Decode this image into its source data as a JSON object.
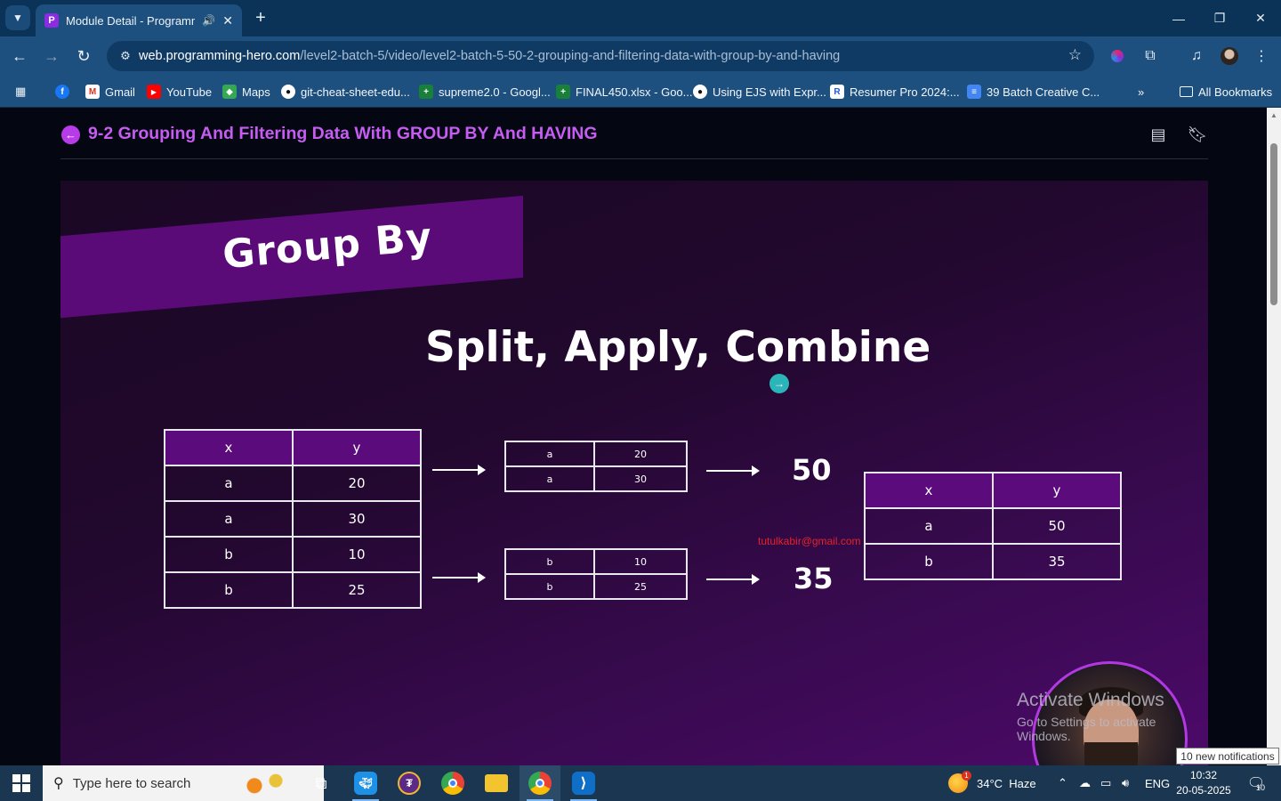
{
  "browser": {
    "tab": {
      "title": "Module Detail - Programmi",
      "favicon": "P"
    },
    "url": {
      "host": "web.programming-hero.com",
      "path": "/level2-batch-5/video/level2-batch-5-50-2-grouping-and-filtering-data-with-group-by-and-having"
    },
    "bookmarks": [
      {
        "label": "Gmail",
        "icon": "gmail-icon",
        "color": "#d93025",
        "glyph": "M"
      },
      {
        "label": "YouTube",
        "icon": "youtube-icon",
        "color": "#ff0000",
        "glyph": "▶"
      },
      {
        "label": "Maps",
        "icon": "maps-icon",
        "color": "#34a853",
        "glyph": "◆"
      },
      {
        "label": "git-cheat-sheet-edu...",
        "icon": "github-icon",
        "color": "#111111",
        "glyph": "●"
      },
      {
        "label": "supreme2.0 - Googl...",
        "icon": "sheets-icon",
        "color": "#188038",
        "glyph": "+"
      },
      {
        "label": "FINAL450.xlsx - Goo...",
        "icon": "sheets-icon",
        "color": "#188038",
        "glyph": "+"
      },
      {
        "label": "Using EJS with Expr...",
        "icon": "github-icon",
        "color": "#111111",
        "glyph": "●"
      },
      {
        "label": "Resumer Pro 2024:...",
        "icon": "resumer-icon",
        "color": "#2557d6",
        "glyph": "R"
      },
      {
        "label": "39 Batch Creative C...",
        "icon": "docs-icon",
        "color": "#4285f4",
        "glyph": "≡"
      }
    ],
    "all_bookmarks": "All Bookmarks"
  },
  "page": {
    "module_title": "9-2 Grouping And Filtering Data With GROUP BY And HAVING"
  },
  "slide": {
    "banner": "Group By",
    "headline": "Split, Apply, Combine",
    "source_table": {
      "headers": [
        "x",
        "y"
      ],
      "rows": [
        [
          "a",
          "20"
        ],
        [
          "a",
          "30"
        ],
        [
          "b",
          "10"
        ],
        [
          "b",
          "25"
        ]
      ]
    },
    "group_a": [
      [
        "a",
        "20"
      ],
      [
        "a",
        "30"
      ]
    ],
    "group_b": [
      [
        "b",
        "10"
      ],
      [
        "b",
        "25"
      ]
    ],
    "sum_a": "50",
    "sum_b": "35",
    "result_table": {
      "headers": [
        "x",
        "y"
      ],
      "rows": [
        [
          "a",
          "50"
        ],
        [
          "b",
          "35"
        ]
      ]
    },
    "watermark_email": "tutulkabir@gmail.com",
    "activate_line1": "Activate Windows",
    "activate_line2": "Go to Settings to activate Windows."
  },
  "taskbar": {
    "search_placeholder": "Type here to search",
    "weather": "34°C  Haze",
    "weather_badge": "1",
    "language": "ENG",
    "time": "10:32",
    "date": "20-05-2025",
    "notifications_toast": "10 new notifications",
    "notifications_count": "10"
  },
  "colors": {
    "accent": "#c75cf2",
    "slide_header": "#5c0b7d",
    "chrome": "#1d4f7f"
  }
}
